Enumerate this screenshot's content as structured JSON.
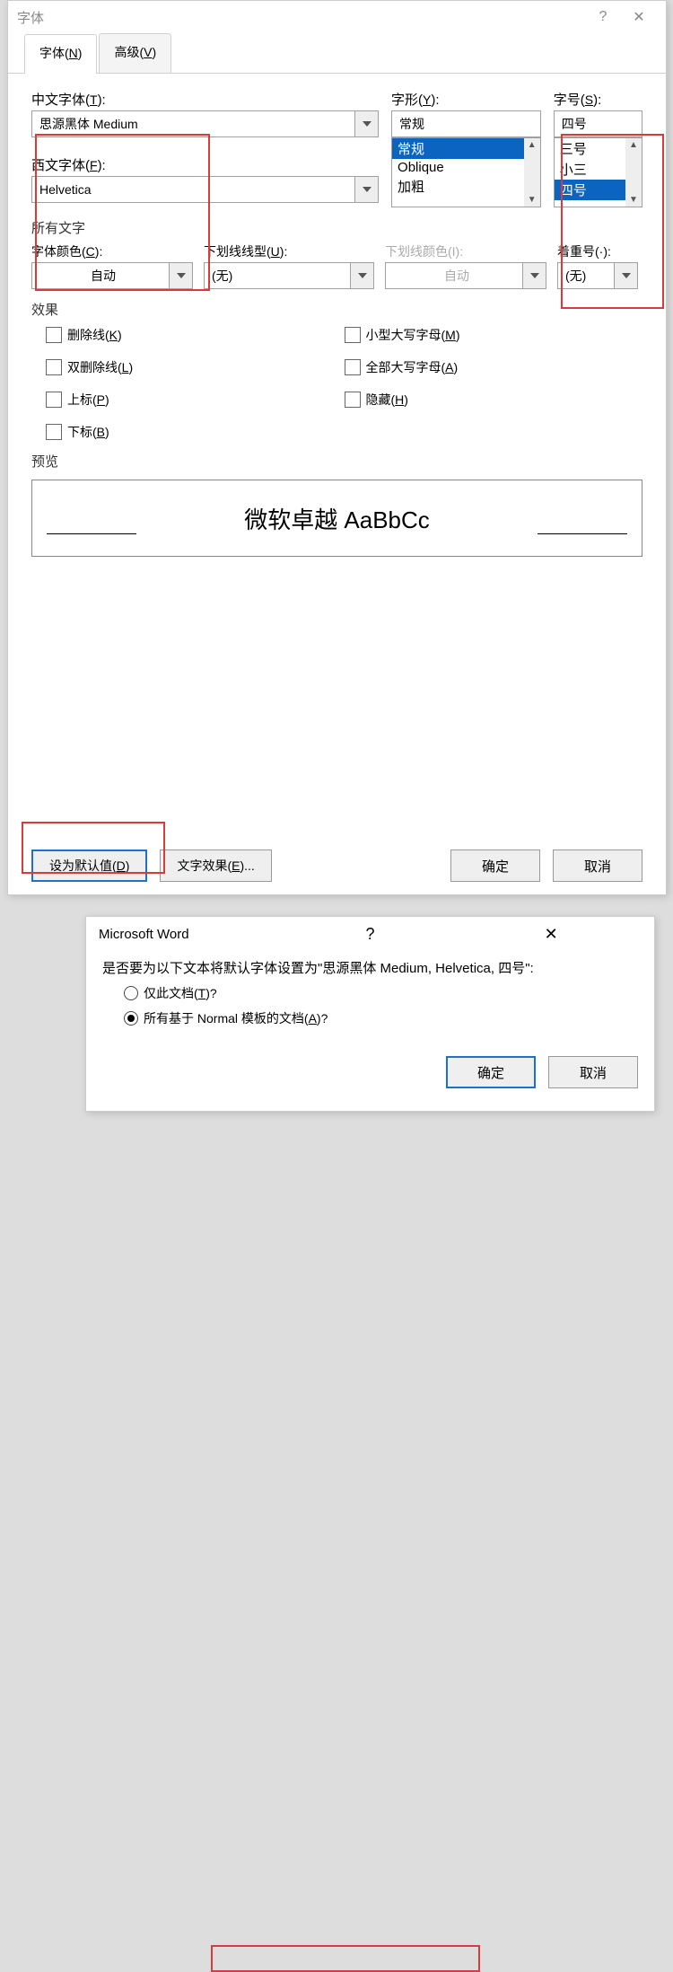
{
  "dialog": {
    "title": "字体",
    "help": "?",
    "close": "✕",
    "tabs": {
      "font": "字体(N)",
      "advanced": "高级(V)"
    },
    "fields": {
      "chinese_font_label": "中文字体(T):",
      "chinese_font_value": "思源黑体 Medium",
      "latin_font_label": "西文字体(F):",
      "latin_font_value": "Helvetica",
      "style_label": "字形(Y):",
      "style_value": "常规",
      "style_list": [
        "常规",
        "Oblique",
        "加粗"
      ],
      "size_label": "字号(S):",
      "size_value": "四号",
      "size_list": [
        "三号",
        "小三",
        "四号"
      ]
    },
    "all_text": {
      "label": "所有文字",
      "color_label": "字体颜色(C):",
      "color_value": "自动",
      "underline_label": "下划线线型(U):",
      "underline_value": "(无)",
      "underline_color_label": "下划线颜色(I):",
      "underline_color_value": "自动",
      "emphasis_label": "着重号(·):",
      "emphasis_value": "(无)"
    },
    "effects": {
      "label": "效果",
      "strike": "删除线(K)",
      "dbl_strike": "双删除线(L)",
      "superscript": "上标(P)",
      "subscript": "下标(B)",
      "small_caps": "小型大写字母(M)",
      "all_caps": "全部大写字母(A)",
      "hidden": "隐藏(H)"
    },
    "preview": {
      "label": "预览",
      "text": "微软卓越 AaBbCc"
    },
    "buttons": {
      "default": "设为默认值(D)",
      "text_effects": "文字效果(E)...",
      "ok": "确定",
      "cancel": "取消"
    }
  },
  "confirm": {
    "title": "Microsoft Word",
    "help": "?",
    "close": "✕",
    "message": "是否要为以下文本将默认字体设置为\"思源黑体 Medium, Helvetica, 四号\":",
    "opt1": "仅此文档(T)?",
    "opt2": "所有基于 Normal 模板的文档(A)?",
    "ok": "确定",
    "cancel": "取消"
  }
}
